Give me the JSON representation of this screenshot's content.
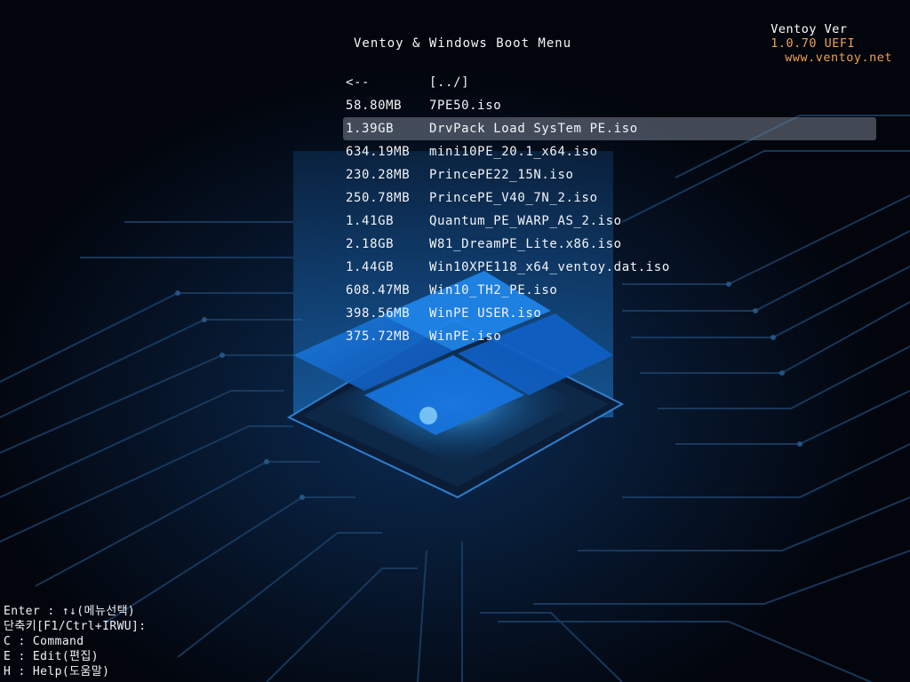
{
  "header": {
    "product": "Ventoy Ver",
    "version": "1.0.70 UEFI",
    "url": "www.ventoy.net"
  },
  "menu": {
    "title": "Ventoy & Windows Boot Menu",
    "selected_index": 2,
    "items": [
      {
        "size": "<--",
        "name": "[../]"
      },
      {
        "size": "58.80MB",
        "name": "7PE50.iso"
      },
      {
        "size": "1.39GB",
        "name": "DrvPack Load SysTem PE.iso"
      },
      {
        "size": "634.19MB",
        "name": "mini10PE_20.1_x64.iso"
      },
      {
        "size": "230.28MB",
        "name": "PrincePE22_15N.iso"
      },
      {
        "size": "250.78MB",
        "name": "PrincePE_V40_7N_2.iso"
      },
      {
        "size": "1.41GB",
        "name": "Quantum_PE_WARP_AS_2.iso"
      },
      {
        "size": "2.18GB",
        "name": "W81_DreamPE_Lite.x86.iso"
      },
      {
        "size": "1.44GB",
        "name": "Win10XPE118_x64_ventoy.dat.iso"
      },
      {
        "size": "608.47MB",
        "name": "Win10_TH2_PE.iso"
      },
      {
        "size": "398.56MB",
        "name": "WinPE USER.iso"
      },
      {
        "size": "375.72MB",
        "name": "WinPE.iso"
      }
    ]
  },
  "help": {
    "enter": "Enter : ↑↓(메뉴선택)",
    "hotkey": "단축키[F1/Ctrl+IRWU]:",
    "command": "C : Command",
    "edit": "E : Edit(편집)",
    "helpline": "H : Help(도움말)"
  },
  "colors": {
    "background": "#02050c",
    "accent": "#f0a050",
    "selection": "#7a8291",
    "glow": "#2f8fe8"
  }
}
